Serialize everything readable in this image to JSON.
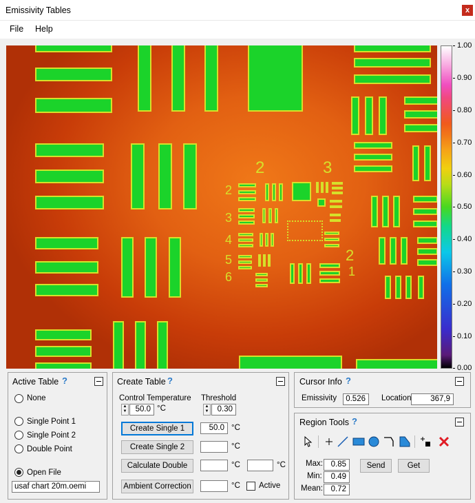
{
  "window": {
    "title": "Emissivity Tables",
    "close": "x"
  },
  "menu": {
    "file": "File",
    "help": "Help"
  },
  "image": {
    "labels": {
      "g2": "2",
      "g3": "3",
      "e2a": "2",
      "e3": "3",
      "e4": "4",
      "e5": "5",
      "e6": "6",
      "r2": "2",
      "r1": "1"
    }
  },
  "colorbar": {
    "ticks": [
      "1.00",
      "0.90",
      "0.80",
      "0.70",
      "0.60",
      "0.50",
      "0.40",
      "0.30",
      "0.20",
      "0.10",
      "0.00"
    ]
  },
  "active_table": {
    "title": "Active Table",
    "help": "?",
    "options": [
      "None",
      "Single Point 1",
      "Single Point 2",
      "Double Point",
      "Open File"
    ],
    "selected": "Open File",
    "file": "usaf chart 20m.oemi"
  },
  "create_table": {
    "title": "Create Table",
    "help": "?",
    "control_temp_label": "Control Temperature",
    "control_temp": "50.0",
    "unit": "°C",
    "threshold_label": "Threshold",
    "threshold": "0.30",
    "btn_single1": "Create Single 1",
    "single1_value": "50.0",
    "btn_single2": "Create Single 2",
    "btn_double": "Calculate Double",
    "btn_ambient": "Ambient Correction",
    "active_label": "Active"
  },
  "cursor_info": {
    "title": "Cursor Info",
    "help": "?",
    "emissivity_label": "Emissivity",
    "emissivity": "0.526",
    "location_label": "Location",
    "location": "367,9"
  },
  "region_tools": {
    "title": "Region Tools",
    "help": "?",
    "max_label": "Max:",
    "max": "0.85",
    "min_label": "Min:",
    "min": "0.49",
    "mean_label": "Mean:",
    "mean": "0.72",
    "send": "Send",
    "get": "Get"
  }
}
